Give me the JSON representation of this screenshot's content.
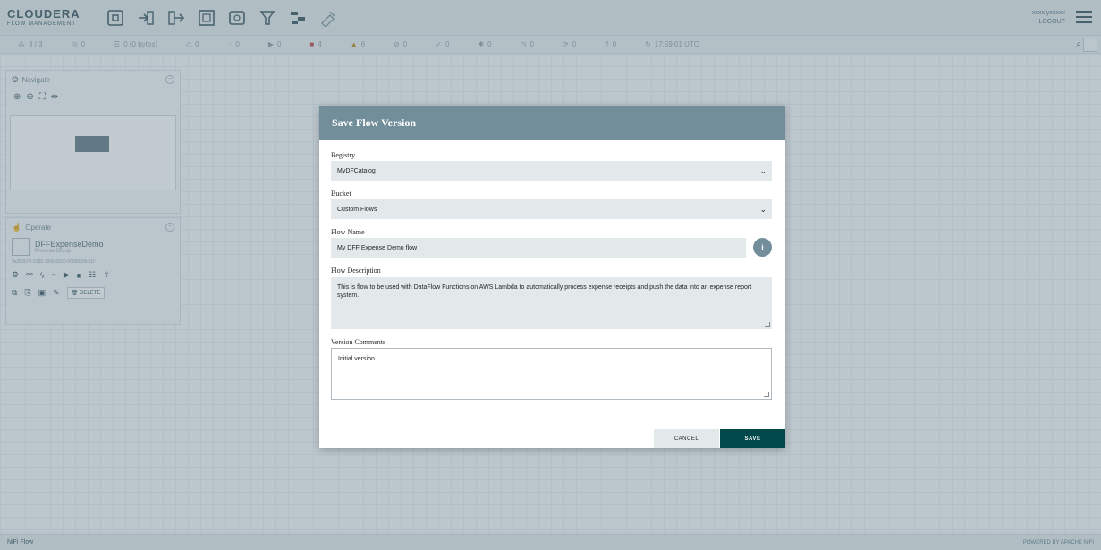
{
  "header": {
    "logo_line1": "CLOUDERA",
    "logo_line2": "FLOW MANAGEMENT",
    "user_name": "xxxx.yxxxxx",
    "user_logout": "LOGOUT"
  },
  "status": {
    "threads": "3 / 3",
    "s1": "0",
    "queued": "0 (0 bytes)",
    "s3": "0",
    "s4": "0",
    "s5": "0",
    "stopped": "4",
    "warnings": "6",
    "s8": "0",
    "s9": "0",
    "s10": "0",
    "s11": "0",
    "s12": "0",
    "s13": "0",
    "refreshed": "17:59:01 UTC"
  },
  "navigate": {
    "title": "Navigate"
  },
  "operate": {
    "title": "Operate",
    "group_name": "DFFExpenseDemo",
    "group_type": "Process Group",
    "group_id": "9a2b0079-0185-1000-0000-0000055fc91f",
    "delete_label": "DELETE"
  },
  "footer": {
    "breadcrumb": "NiFi Flow",
    "brand": "POWERED BY APACHE NIFI"
  },
  "dialog": {
    "title": "Save Flow Version",
    "registry_label": "Registry",
    "registry_value": "MyDFCatalog",
    "bucket_label": "Bucket",
    "bucket_value": "Custom Flows",
    "flow_name_label": "Flow Name",
    "flow_name_value": "My DFF Expense Demo flow",
    "flow_desc_label": "Flow Description",
    "flow_desc_value": "This is flow to be used with DataFlow Functions on AWS Lambda to automatically process expense receipts and push the data into an expense report system.",
    "version_comments_label": "Version Comments",
    "version_comments_value": "Initial version",
    "info_badge": "i",
    "cancel_label": "CANCEL",
    "save_label": "SAVE"
  },
  "colors": {
    "dialog_header": "#728e9b",
    "save_button": "#004849",
    "overlay": "#6a808d"
  }
}
